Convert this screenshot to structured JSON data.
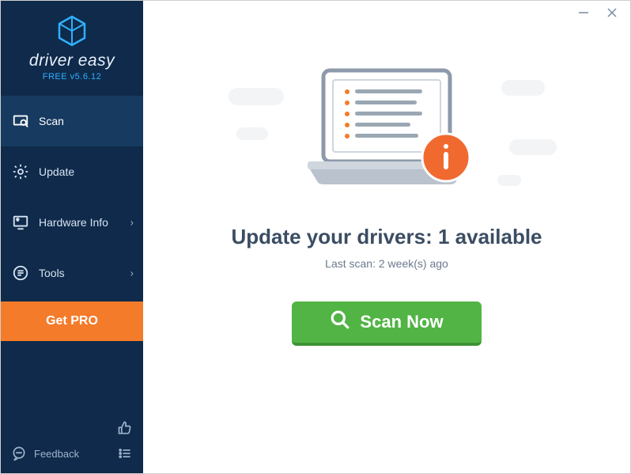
{
  "brand": {
    "name": "driver easy",
    "version_line": "FREE v5.6.12"
  },
  "sidebar": {
    "items": [
      {
        "label": "Scan"
      },
      {
        "label": "Update"
      },
      {
        "label": "Hardware Info"
      },
      {
        "label": "Tools"
      }
    ],
    "get_pro": "Get PRO",
    "feedback": "Feedback"
  },
  "main": {
    "headline": "Update your drivers: 1 available",
    "subline": "Last scan: 2 week(s) ago",
    "scan_button": "Scan Now"
  },
  "colors": {
    "accent_orange": "#f47b2a",
    "accent_green": "#52b445",
    "sidebar_bg": "#0f2a4a"
  }
}
